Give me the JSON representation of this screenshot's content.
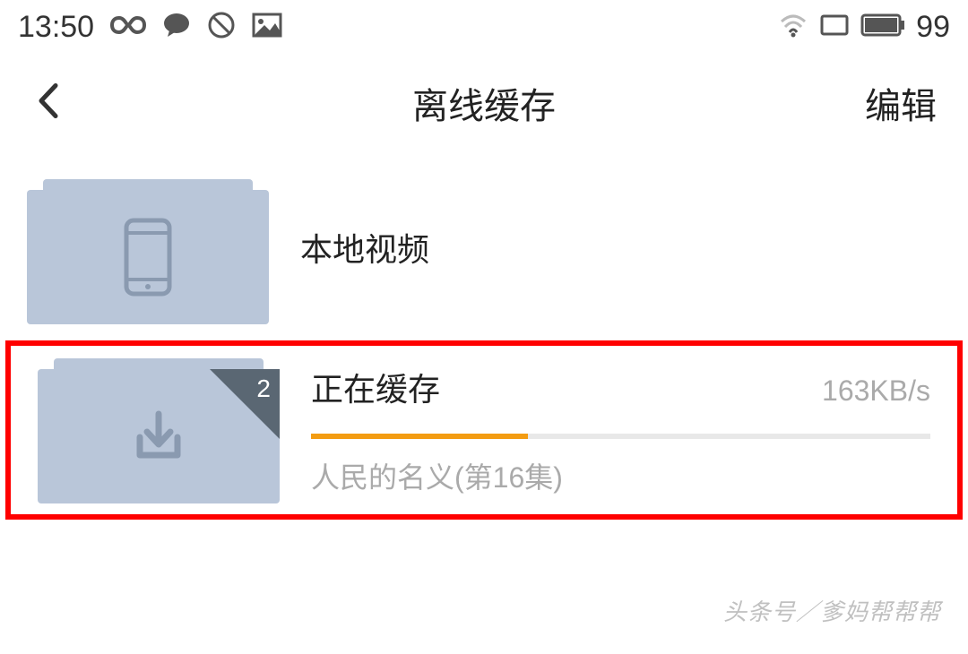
{
  "status": {
    "time": "13:50",
    "battery": "99"
  },
  "nav": {
    "title": "离线缓存",
    "edit": "编辑"
  },
  "items": {
    "local": {
      "title": "本地视频"
    },
    "caching": {
      "title": "正在缓存",
      "badge": "2",
      "speed": "163KB/s",
      "progress_percent": 35,
      "subtitle": "人民的名义(第16集)"
    }
  },
  "watermark": "头条号／爹妈帮帮帮"
}
